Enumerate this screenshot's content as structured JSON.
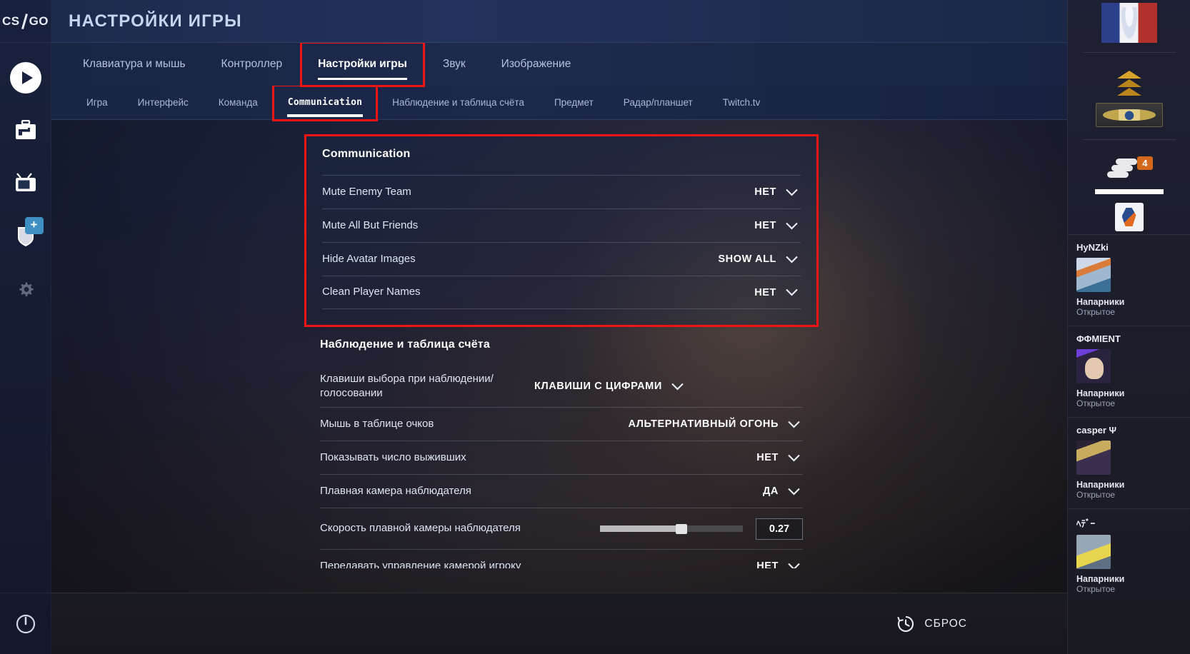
{
  "brand": {
    "logo_cs": "CS",
    "logo_go": "GO"
  },
  "header": {
    "title": "НАСТРОЙКИ ИГРЫ"
  },
  "tabs": [
    {
      "label": "Клавиатура и мышь",
      "active": false
    },
    {
      "label": "Контроллер",
      "active": false
    },
    {
      "label": "Настройки игры",
      "active": true,
      "highlighted": true
    },
    {
      "label": "Звук",
      "active": false
    },
    {
      "label": "Изображение",
      "active": false
    }
  ],
  "subtabs": [
    {
      "label": "Игра",
      "active": false
    },
    {
      "label": "Интерфейс",
      "active": false
    },
    {
      "label": "Команда",
      "active": false
    },
    {
      "label": "Communication",
      "active": true,
      "highlighted": true
    },
    {
      "label": "Наблюдение и таблица счёта",
      "active": false
    },
    {
      "label": "Предмет",
      "active": false
    },
    {
      "label": "Радар/планшет",
      "active": false
    },
    {
      "label": "Twitch.tv",
      "active": false
    }
  ],
  "sections": [
    {
      "title": "Communication",
      "highlighted": true,
      "rows": [
        {
          "label": "Mute Enemy Team",
          "value": "НЕТ",
          "control": "dropdown"
        },
        {
          "label": "Mute All But Friends",
          "value": "НЕТ",
          "control": "dropdown"
        },
        {
          "label": "Hide Avatar Images",
          "value": "SHOW ALL",
          "control": "dropdown"
        },
        {
          "label": "Clean Player Names",
          "value": "НЕТ",
          "control": "dropdown"
        }
      ]
    },
    {
      "title": "Наблюдение и таблица счёта",
      "highlighted": false,
      "rows": [
        {
          "label": "Клавиши выбора при наблюдении/голосовании",
          "value": "КЛАВИШИ С ЦИФРАМИ",
          "control": "dropdown"
        },
        {
          "label": "Мышь в таблице очков",
          "value": "АЛЬТЕРНАТИВНЫЙ ОГОНЬ",
          "control": "dropdown"
        },
        {
          "label": "Показывать число выживших",
          "value": "НЕТ",
          "control": "dropdown"
        },
        {
          "label": "Плавная камера наблюдателя",
          "value": "ДА",
          "control": "dropdown"
        },
        {
          "label": "Скорость плавной камеры наблюдателя",
          "value": "0.27",
          "control": "slider",
          "slider_percent": 55
        },
        {
          "label": "Передавать управление камерой игроку",
          "value": "НЕТ",
          "control": "dropdown"
        }
      ]
    }
  ],
  "bottom_bar": {
    "reset_label": "СБРОС"
  },
  "rail": {
    "items": [
      {
        "name": "play",
        "label": "Играть"
      },
      {
        "name": "inventory",
        "label": "Инвентарь"
      },
      {
        "name": "watch",
        "label": "Смотреть"
      },
      {
        "name": "shield",
        "label": "Хранилище",
        "badge": "+"
      },
      {
        "name": "settings",
        "label": "Настройки"
      }
    ],
    "power_label": "Выход"
  },
  "friends_panel": {
    "rounds_count": "4",
    "friends": [
      {
        "name": "HyNZki",
        "status": "Напарники",
        "substatus": "Открытое"
      },
      {
        "name": "ΦΦMIENT",
        "status": "Напарники",
        "substatus": "Открытое"
      },
      {
        "name": "casper Ψ",
        "status": "Напарники",
        "substatus": "Открытое"
      },
      {
        "name": "ﾍﾃﾞｰ",
        "status": "Напарники",
        "substatus": "Открытое"
      }
    ]
  },
  "colors": {
    "accent_red": "#f01414",
    "panel_blue": "#1d2a4d",
    "text_primary": "#ffffff"
  }
}
